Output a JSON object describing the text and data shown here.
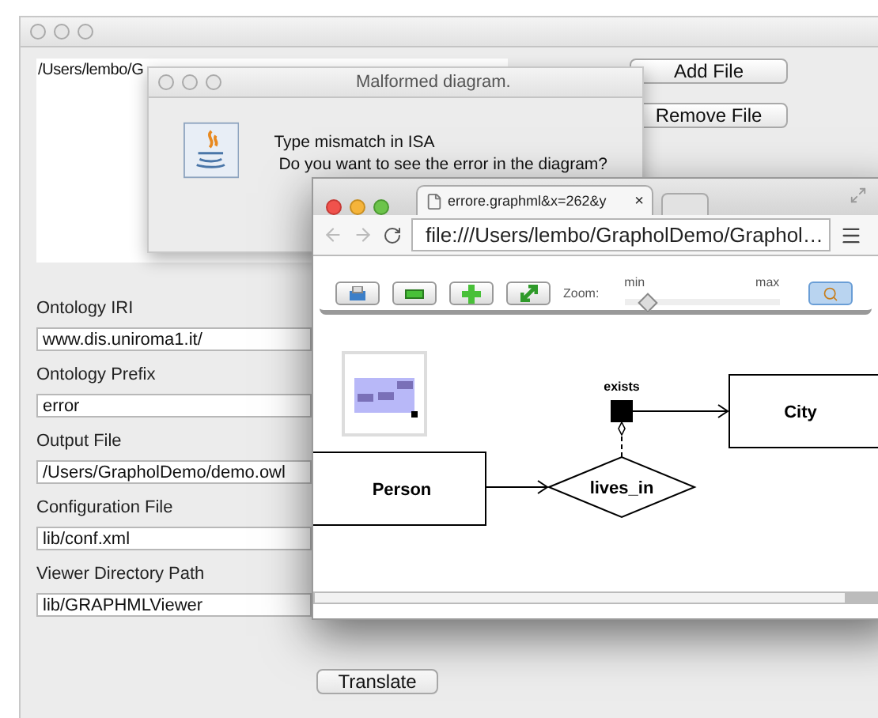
{
  "main_window": {
    "file_list": [
      "/Users/lembo/G"
    ],
    "buttons": [
      "Add File",
      "Remove File"
    ],
    "fields": [
      {
        "label": "Ontology IRI",
        "value": "www.dis.uniroma1.it/"
      },
      {
        "label": "Ontology Prefix",
        "value": "error"
      },
      {
        "label": "Output File",
        "value": "/Users/GrapholDemo/demo.owl"
      },
      {
        "label": "Configuration File",
        "value": "lib/conf.xml"
      },
      {
        "label": "Viewer Directory Path",
        "value": "lib/GRAPHMLViewer"
      }
    ],
    "action_button": "Translate"
  },
  "dialog": {
    "title": "Malformed diagram.",
    "message": [
      "Type mismatch in ISA",
      "Do you want to see the error in the diagram?"
    ]
  },
  "browser": {
    "tab": {
      "title": "errore.graphml&x=262&y",
      "close": "×"
    },
    "address": "file:///Users/lembo/GrapholDemo/Graphol…",
    "toolbar": {
      "zoom_label": "Zoom:",
      "zoom_min": "min",
      "zoom_max": "max",
      "zoom": {
        "level": 0.15
      }
    },
    "diagram": {
      "nodes": [
        {
          "kind": "concept",
          "label": "Person"
        },
        {
          "kind": "role",
          "label": "lives_in"
        },
        {
          "kind": "restriction",
          "label": "exists"
        },
        {
          "kind": "concept",
          "label": "City"
        }
      ]
    }
  }
}
